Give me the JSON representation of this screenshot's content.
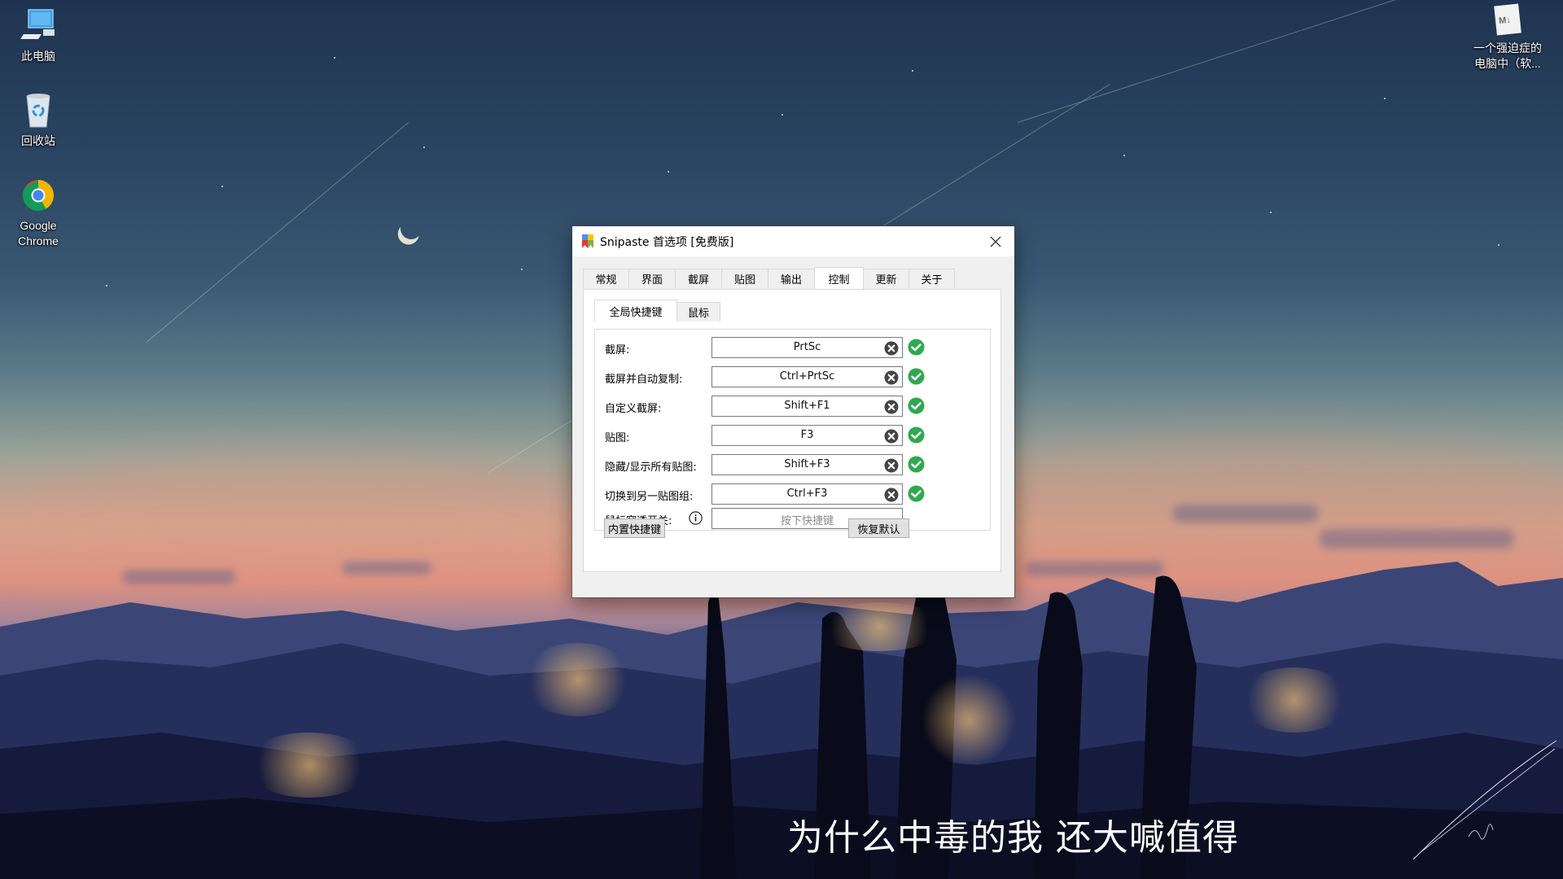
{
  "desktop": {
    "icons": [
      {
        "label": "此电脑",
        "icon": "computer-icon"
      },
      {
        "label": "回收站",
        "icon": "recycle-bin-icon"
      },
      {
        "label_line1": "Google",
        "label_line2": "Chrome",
        "icon": "chrome-icon"
      },
      {
        "label_line1": "一个强迫症的",
        "label_line2": "电脑中（软...",
        "icon": "markdown-file-icon",
        "glyph": "M↓"
      }
    ],
    "subtitle": "为什么中毒的我 还大喊值得"
  },
  "dialog": {
    "title": "Snipaste 首选项 [免费版]",
    "close_icon": "close-icon",
    "tabs": [
      {
        "label": "常规",
        "active": false
      },
      {
        "label": "界面",
        "active": false
      },
      {
        "label": "截屏",
        "active": false
      },
      {
        "label": "贴图",
        "active": false
      },
      {
        "label": "输出",
        "active": false
      },
      {
        "label": "控制",
        "active": true
      },
      {
        "label": "更新",
        "active": false
      },
      {
        "label": "关于",
        "active": false
      }
    ],
    "subtabs": [
      {
        "label": "全局快捷键",
        "active": true
      },
      {
        "label": "鼠标",
        "active": false
      }
    ],
    "hotkeys": [
      {
        "label": "截屏:",
        "value": "PrtSc",
        "status": "ok"
      },
      {
        "label": "截屏并自动复制:",
        "value": "Ctrl+PrtSc",
        "status": "ok"
      },
      {
        "label": "自定义截屏:",
        "value": "Shift+F1",
        "status": "ok"
      },
      {
        "label": "贴图:",
        "value": "F3",
        "status": "ok"
      },
      {
        "label": "隐藏/显示所有贴图:",
        "value": "Shift+F3",
        "status": "ok"
      },
      {
        "label": "切换到另一贴图组:",
        "value": "Ctrl+F3",
        "status": "ok"
      },
      {
        "label": "鼠标穿透开关:",
        "value": "",
        "placeholder": "按下快捷键",
        "has_info": true
      }
    ],
    "buttons": {
      "builtin_hotkeys": "内置快捷键",
      "restore_defaults": "恢复默认"
    },
    "colors": {
      "ok_green": "#2fa84f",
      "clear_gray": "#454545"
    }
  }
}
